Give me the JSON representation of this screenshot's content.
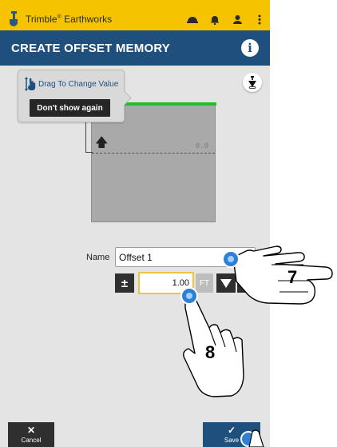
{
  "app": {
    "name": "Trimble",
    "reg": "®",
    "name_suffix": " Earthworks"
  },
  "header": {
    "title": "CREATE OFFSET MEMORY"
  },
  "tooltip": {
    "hint": "Drag To Change Value",
    "dismiss": "Don't show again"
  },
  "drawing": {
    "value": "0.0"
  },
  "form": {
    "name_label": "Name",
    "name_value": "Offset 1",
    "plus_minus": "±",
    "offset_value": "1.00",
    "unit": "FT"
  },
  "footer": {
    "cancel": "Cancel",
    "save": "Save",
    "cancel_glyph": "✕",
    "save_glyph": "✓"
  },
  "annotations": {
    "step_a": "7",
    "step_b": "8"
  },
  "colors": {
    "accent_yellow": "#f6c300",
    "header_blue": "#1f4f7c",
    "surface_line": "#1fbf2a",
    "touch_blue": "#2f7fd6"
  },
  "icons": [
    "trimble-logo-icon",
    "hardhat-icon",
    "bell-icon",
    "person-icon",
    "more-vert-icon",
    "info-icon",
    "drag-hand-icon",
    "plumb-bob-icon",
    "down-arrow-icon",
    "up-arrow-icon",
    "tap-hand-icon"
  ]
}
